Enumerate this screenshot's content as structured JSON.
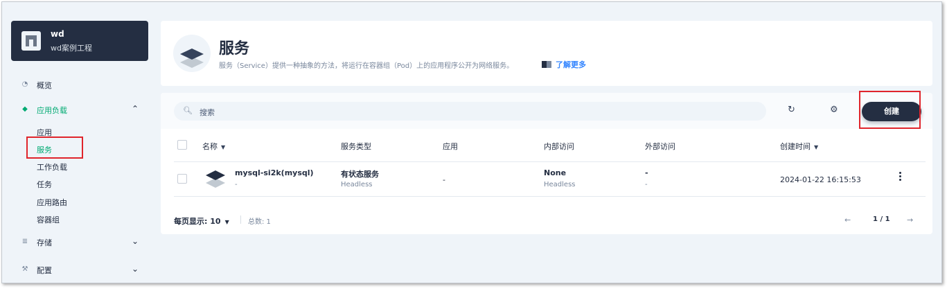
{
  "workspace": {
    "name": "wd",
    "description": "wd案例工程"
  },
  "nav": {
    "overview": "概览",
    "workloads": "应用负载",
    "sub": [
      "应用",
      "服务",
      "工作负载",
      "任务",
      "应用路由",
      "容器组"
    ],
    "storage": "存储",
    "config": "配置"
  },
  "header": {
    "title": "服务",
    "description": "服务（Service）提供一种抽象的方法，将运行在容器组（Pod）上的应用程序公开为网络服务。",
    "learn_more": "了解更多"
  },
  "toolbar": {
    "search_placeholder": "搜索",
    "create_label": "创建"
  },
  "table": {
    "columns": [
      "名称",
      "服务类型",
      "应用",
      "内部访问",
      "外部访问",
      "创建时间"
    ],
    "rows": [
      {
        "name": "mysql-si2k(mysql)",
        "name_sub": "-",
        "type": "有状态服务",
        "type_sub": "Headless",
        "app": "-",
        "internal": "None",
        "internal_sub": "Headless",
        "external": "-",
        "external_sub": "-",
        "created": "2024-01-22 16:15:53"
      }
    ]
  },
  "footer": {
    "page_size_label": "每页显示:",
    "page_size": "10",
    "total": "总数: 1",
    "pages": "1 / 1"
  },
  "colors": {
    "accent": "#00aa72",
    "dark": "#242e42",
    "highlight": "#e0242b",
    "link": "#3385ff"
  },
  "icons": [
    "building-icon",
    "dashboard-icon",
    "layers-icon",
    "chevron-up-icon",
    "chevron-down-icon",
    "database-icon",
    "hammer-icon",
    "service-icon",
    "book-icon",
    "search-icon",
    "refresh-icon",
    "gear-icon",
    "caret-down-icon",
    "kebab-icon",
    "arrow-left-icon",
    "arrow-right-icon"
  ]
}
